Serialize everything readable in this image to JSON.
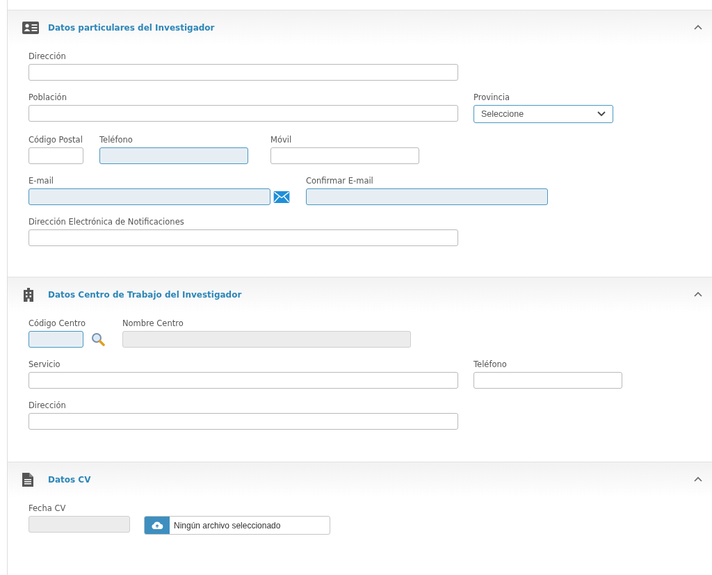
{
  "sections": [
    {
      "title": "Datos particulares del Investigador",
      "expanded": true,
      "rows": [
        [
          {
            "label": "Dirección",
            "kind": "text",
            "highlighted": false,
            "disabled": false
          }
        ],
        [
          {
            "label": "Población",
            "kind": "text",
            "highlighted": false,
            "disabled": false
          },
          {
            "label": "Provincia",
            "kind": "select",
            "value": "Seleccione",
            "highlighted": true,
            "disabled": false
          }
        ],
        [
          {
            "label": "Código Postal",
            "kind": "text",
            "highlighted": false,
            "disabled": false
          },
          {
            "label": "Teléfono",
            "kind": "text",
            "highlighted": true,
            "disabled": false
          },
          {
            "label": "Móvil",
            "kind": "text",
            "highlighted": false,
            "disabled": false
          }
        ],
        [
          {
            "label": "E-mail",
            "kind": "email",
            "highlighted": true,
            "disabled": false
          },
          {
            "label": "Confirmar E-mail",
            "kind": "text",
            "highlighted": true,
            "disabled": false
          }
        ],
        [
          {
            "label": "Dirección Electrónica de Notificaciones",
            "kind": "text",
            "highlighted": false,
            "disabled": false
          }
        ]
      ]
    },
    {
      "title": "Datos Centro de Trabajo del Investigador",
      "expanded": true,
      "rows": [
        [
          {
            "label": "Código Centro",
            "kind": "lookup",
            "highlighted": true,
            "disabled": false
          },
          {
            "label": "Nombre Centro",
            "kind": "text",
            "highlighted": false,
            "disabled": true
          }
        ],
        [
          {
            "label": "Servicio",
            "kind": "text",
            "highlighted": false,
            "disabled": false
          },
          {
            "label": "Teléfono",
            "kind": "text",
            "highlighted": false,
            "disabled": false
          }
        ],
        [
          {
            "label": "Dirección",
            "kind": "text",
            "highlighted": false,
            "disabled": false
          }
        ]
      ]
    },
    {
      "title": "Datos CV",
      "expanded": true,
      "rows": [
        [
          {
            "label": "Fecha CV",
            "kind": "text",
            "highlighted": false,
            "disabled": true
          },
          {
            "kind": "file",
            "value": "Ningún archivo seleccionado",
            "highlighted": false,
            "disabled": false
          }
        ]
      ]
    }
  ]
}
